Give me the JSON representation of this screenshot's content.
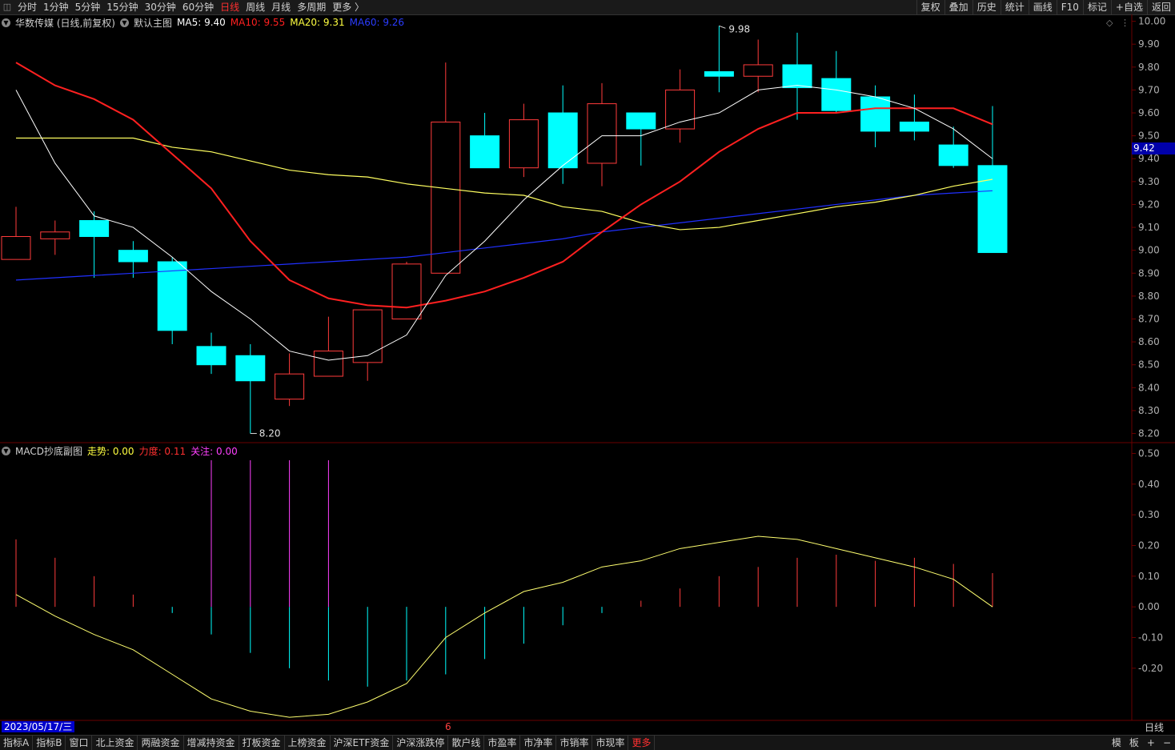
{
  "toolbar": {
    "periods": [
      "分时",
      "1分钟",
      "5分钟",
      "15分钟",
      "30分钟",
      "60分钟",
      "日线",
      "周线",
      "月线",
      "多周期",
      "更多 〉"
    ],
    "active_period": "日线",
    "right_buttons": [
      "复权",
      "叠加",
      "历史",
      "统计",
      "画线",
      "F10",
      "标记",
      "+自选",
      "返回"
    ]
  },
  "main_legend": {
    "stock": "华数传媒 (日线,前复权)",
    "template": "默认主图",
    "ma5": "MA5: 9.40",
    "ma10": "MA10: 9.55",
    "ma20": "MA20: 9.31",
    "ma60": "MA60: 9.26"
  },
  "sub_legend": {
    "name": "MACD抄底副图",
    "trend": "走势: 0.00",
    "force": "力度: 0.11",
    "focus": "关注: 0.00"
  },
  "current_price": "9.42",
  "high_label": "9.98",
  "low_label": "8.20",
  "date_label": "2023/05/17/三",
  "month_mark": "6",
  "period_label": "日线",
  "bottom_tabs": [
    "指标A",
    "指标B",
    "窗口",
    "北上资金",
    "两融资金",
    "增减持资金",
    "打板资金",
    "上榜资金",
    "沪深ETF资金",
    "沪深涨跌停",
    "散户线",
    "市盈率",
    "市净率",
    "市销率",
    "市现率",
    "更多"
  ],
  "bottom_right": [
    "模",
    "板",
    "+",
    "−"
  ],
  "colors": {
    "up": "#ff3b3b",
    "down": "#00ffff",
    "ma5": "#ffffff",
    "ma10": "#ff2020",
    "ma20": "#ffff60",
    "ma60": "#2030ff",
    "grid": "#6a0000",
    "magenta": "#ff40ff"
  },
  "chart_data": [
    {
      "type": "candlestick",
      "title": "华数传媒 (日线,前复权)",
      "y_ticks": [
        10.0,
        9.9,
        9.8,
        9.7,
        9.6,
        9.5,
        9.4,
        9.3,
        9.2,
        9.1,
        9.0,
        8.9,
        8.8,
        8.7,
        8.6,
        8.5,
        8.4,
        8.3,
        8.2
      ],
      "ylim": [
        8.16,
        10.03
      ],
      "candles": [
        {
          "o": 8.96,
          "h": 9.19,
          "l": 8.96,
          "c": 9.06
        },
        {
          "o": 9.05,
          "h": 9.13,
          "l": 8.98,
          "c": 9.08
        },
        {
          "o": 9.13,
          "h": 9.17,
          "l": 8.88,
          "c": 9.06
        },
        {
          "o": 9.0,
          "h": 9.04,
          "l": 8.88,
          "c": 8.95
        },
        {
          "o": 8.95,
          "h": 8.97,
          "l": 8.59,
          "c": 8.65
        },
        {
          "o": 8.58,
          "h": 8.64,
          "l": 8.46,
          "c": 8.5
        },
        {
          "o": 8.54,
          "h": 8.59,
          "l": 8.2,
          "c": 8.43
        },
        {
          "o": 8.35,
          "h": 8.55,
          "l": 8.32,
          "c": 8.46
        },
        {
          "o": 8.45,
          "h": 8.71,
          "l": 8.45,
          "c": 8.56
        },
        {
          "o": 8.51,
          "h": 8.74,
          "l": 8.43,
          "c": 8.74
        },
        {
          "o": 8.7,
          "h": 8.95,
          "l": 8.7,
          "c": 8.94
        },
        {
          "o": 8.9,
          "h": 9.82,
          "l": 8.9,
          "c": 9.56
        },
        {
          "o": 9.5,
          "h": 9.6,
          "l": 9.36,
          "c": 9.36
        },
        {
          "o": 9.36,
          "h": 9.64,
          "l": 9.32,
          "c": 9.57
        },
        {
          "o": 9.6,
          "h": 9.72,
          "l": 9.29,
          "c": 9.36
        },
        {
          "o": 9.38,
          "h": 9.73,
          "l": 9.28,
          "c": 9.64
        },
        {
          "o": 9.6,
          "h": 9.6,
          "l": 9.37,
          "c": 9.53
        },
        {
          "o": 9.53,
          "h": 9.79,
          "l": 9.47,
          "c": 9.7
        },
        {
          "o": 9.78,
          "h": 9.98,
          "l": 9.69,
          "c": 9.76
        },
        {
          "o": 9.76,
          "h": 9.92,
          "l": 9.69,
          "c": 9.81
        },
        {
          "o": 9.81,
          "h": 9.95,
          "l": 9.57,
          "c": 9.71
        },
        {
          "o": 9.75,
          "h": 9.87,
          "l": 9.6,
          "c": 9.61
        },
        {
          "o": 9.67,
          "h": 9.72,
          "l": 9.45,
          "c": 9.52
        },
        {
          "o": 9.56,
          "h": 9.68,
          "l": 9.48,
          "c": 9.52
        },
        {
          "o": 9.46,
          "h": 9.54,
          "l": 9.36,
          "c": 9.37
        },
        {
          "o": 9.37,
          "h": 9.63,
          "l": 8.99,
          "c": 8.99
        }
      ],
      "ma5": [
        9.7,
        9.38,
        9.15,
        9.1,
        8.97,
        8.82,
        8.7,
        8.56,
        8.52,
        8.54,
        8.63,
        8.89,
        9.04,
        9.22,
        9.37,
        9.5,
        9.5,
        9.56,
        9.6,
        9.7,
        9.72,
        9.7,
        9.67,
        9.62,
        9.53,
        9.4
      ],
      "ma10": [
        9.82,
        9.72,
        9.66,
        9.57,
        9.42,
        9.27,
        9.04,
        8.87,
        8.79,
        8.76,
        8.75,
        8.78,
        8.82,
        8.88,
        8.95,
        9.08,
        9.2,
        9.3,
        9.43,
        9.53,
        9.6,
        9.6,
        9.62,
        9.62,
        9.62,
        9.55
      ],
      "ma20": [
        9.49,
        9.49,
        9.49,
        9.49,
        9.45,
        9.43,
        9.39,
        9.35,
        9.33,
        9.32,
        9.29,
        9.27,
        9.25,
        9.24,
        9.19,
        9.17,
        9.12,
        9.09,
        9.1,
        9.13,
        9.16,
        9.19,
        9.21,
        9.24,
        9.28,
        9.31
      ],
      "ma60": [
        8.87,
        8.88,
        8.89,
        8.9,
        8.91,
        8.92,
        8.93,
        8.94,
        8.95,
        8.96,
        8.97,
        8.99,
        9.01,
        9.03,
        9.05,
        9.08,
        9.1,
        9.12,
        9.14,
        9.16,
        9.18,
        9.2,
        9.22,
        9.24,
        9.25,
        9.26
      ]
    },
    {
      "type": "bar",
      "title": "MACD抄底副图",
      "y_ticks": [
        0.5,
        0.4,
        0.3,
        0.2,
        0.1,
        0.0,
        -0.1,
        -0.2
      ],
      "ylim": [
        -0.37,
        0.53
      ],
      "bars": [
        0.22,
        0.16,
        0.1,
        0.04,
        -0.02,
        -0.09,
        -0.15,
        -0.2,
        -0.24,
        -0.26,
        -0.24,
        -0.22,
        -0.17,
        -0.12,
        -0.06,
        -0.02,
        0.02,
        0.06,
        0.1,
        0.13,
        0.16,
        0.17,
        0.15,
        0.16,
        0.14,
        0.11
      ],
      "magenta_bars": [
        5,
        6,
        7,
        8
      ],
      "line": [
        0.04,
        -0.03,
        -0.09,
        -0.14,
        -0.22,
        -0.3,
        -0.34,
        -0.36,
        -0.35,
        -0.31,
        -0.25,
        -0.1,
        -0.02,
        0.05,
        0.08,
        0.13,
        0.15,
        0.19,
        0.21,
        0.23,
        0.22,
        0.19,
        0.16,
        0.13,
        0.09,
        0.0
      ]
    }
  ]
}
